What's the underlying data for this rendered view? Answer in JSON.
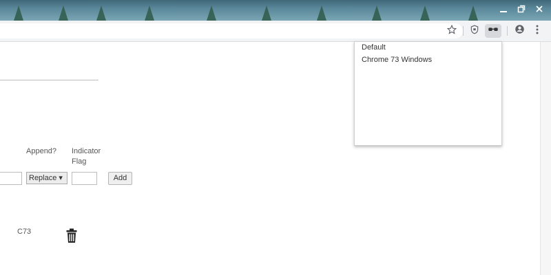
{
  "window": {
    "minimize_icon": "minimize-icon",
    "restore_icon": "restore-icon",
    "close_icon": "close-icon"
  },
  "toolbar": {
    "icons": [
      "star-icon",
      "shield-extension-icon",
      "user-agent-switcher-icon",
      "account-icon",
      "more-menu-icon"
    ]
  },
  "popup": {
    "items": [
      "Default",
      "Chrome 73 Windows"
    ]
  },
  "form": {
    "append_label": "Append?",
    "indicator_flag_label": "Indicator\nFlag",
    "append_select_value": "Replace ▾",
    "add_button_label": "Add"
  },
  "list": {
    "rows": [
      {
        "flag": "C73",
        "delete_icon": "trash-icon"
      }
    ]
  },
  "colors": {
    "toolbar_bg": "#f1f3f4",
    "titlebar": "#5a8799"
  }
}
